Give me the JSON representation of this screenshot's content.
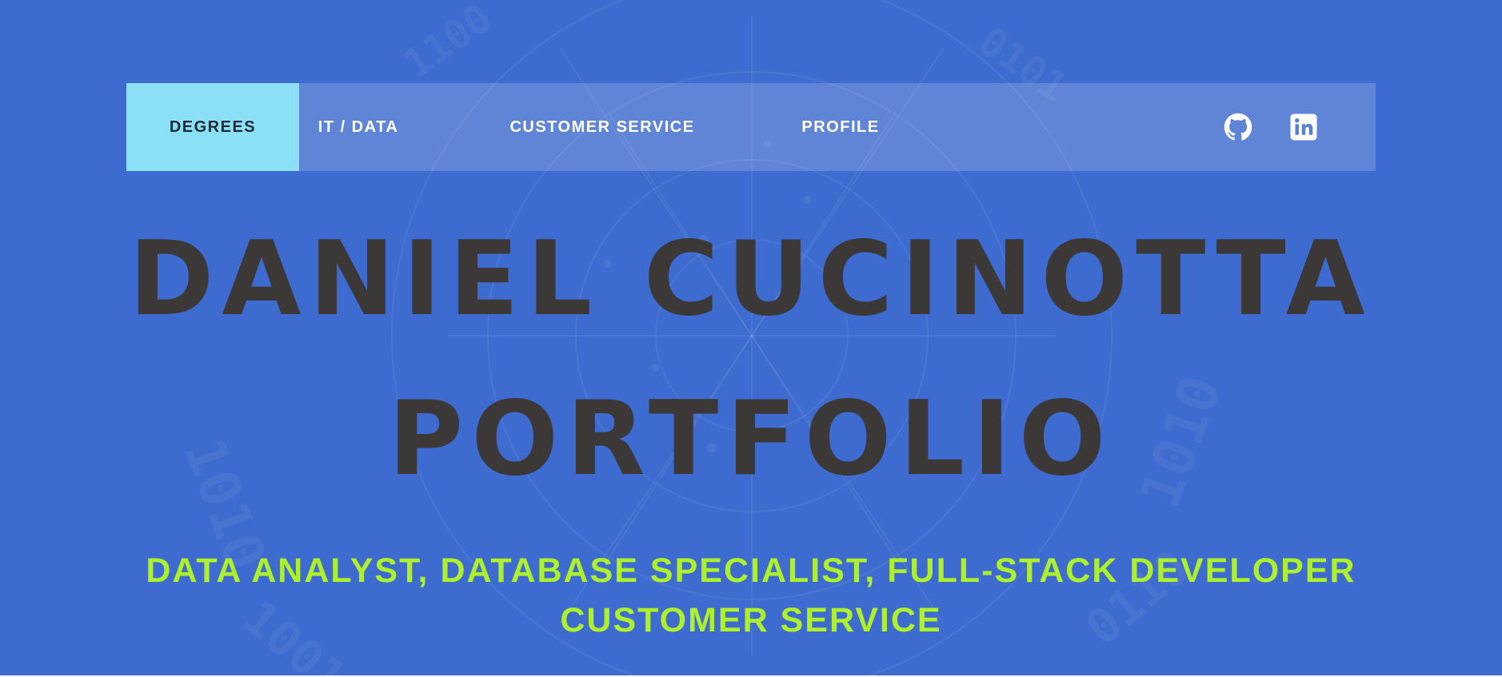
{
  "nav": {
    "items": [
      {
        "label": "DEGREES",
        "active": true
      },
      {
        "label": "IT / DATA",
        "active": false
      },
      {
        "label": "CUSTOMER SERVICE",
        "active": false
      },
      {
        "label": "PROFILE",
        "active": false
      }
    ],
    "icons": [
      "github-icon",
      "linkedin-icon"
    ]
  },
  "hero": {
    "title_line1": "DANIEL CUCINOTTA",
    "title_line2": "PORTFOLIO",
    "subtitle_line1": "DATA ANALYST, DATABASE SPECIALIST, FULL-STACK DEVELOPER",
    "subtitle_line2": "CUSTOMER SERVICE"
  },
  "colors": {
    "background": "#3d6bcf",
    "nav_active_bg": "#8ce0f6",
    "title": "#3d3838",
    "subtitle": "#aef02a"
  }
}
